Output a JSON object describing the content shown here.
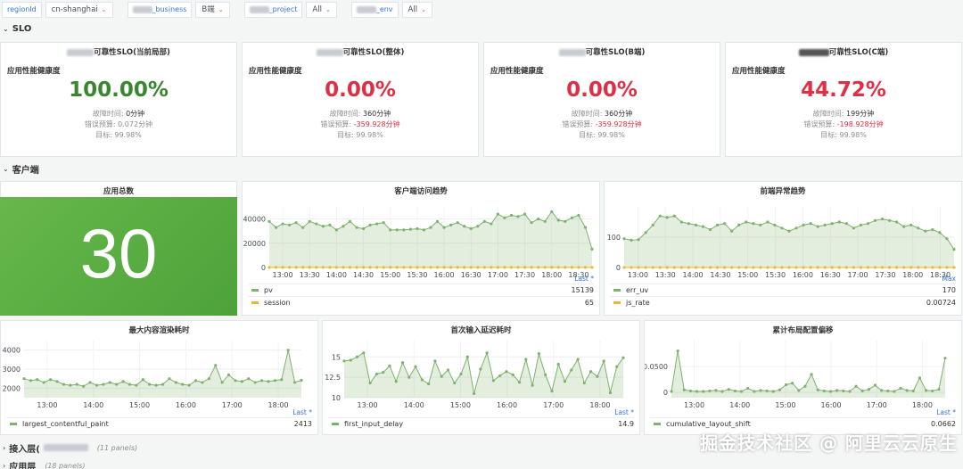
{
  "variables": {
    "region_label": "regionId",
    "region_value": "cn-shanghai",
    "business_label": "_business",
    "business_value": "B端",
    "project_label": "_project",
    "project_value": "All",
    "env_label": "_env",
    "env_value": "All"
  },
  "rows": {
    "slo": "SLO",
    "client": "客户端",
    "access": "接入层(",
    "access_count": "(11 panels)",
    "app": "应用层",
    "app_count": "(18 panels)"
  },
  "slo_panels": [
    {
      "title": "可靠性SLO(当前局部)",
      "subtitle": "应用性能健康度",
      "value": "100.00%",
      "color": "#37872d",
      "downtime_label": "故障时间:",
      "downtime": "0分钟",
      "budget_label": "错误预算:",
      "budget": "0.072分钟",
      "target_label": "目标:",
      "target": "99.98%"
    },
    {
      "title": "可靠性SLO(整体)",
      "subtitle": "应用性能健康度",
      "value": "0.00%",
      "color": "#e02f44",
      "downtime_label": "故障时间:",
      "downtime": "360分钟",
      "budget_label": "错误预算:",
      "budget": "-359.928分钟",
      "target_label": "目标:",
      "target": "99.98%"
    },
    {
      "title": "可靠性SLO(B端)",
      "subtitle": "应用性能健康度",
      "value": "0.00%",
      "color": "#e02f44",
      "downtime_label": "故障时间:",
      "downtime": "360分钟",
      "budget_label": "错误预算:",
      "budget": "-359.928分钟",
      "target_label": "目标:",
      "target": "99.98%"
    },
    {
      "title": "可靠性SLO(C端)",
      "subtitle": "应用性能健康度",
      "value": "44.72%",
      "color": "#e02f44",
      "downtime_label": "故障时间:",
      "downtime": "199分钟",
      "budget_label": "错误预算:",
      "budget": "-198.928分钟",
      "target_label": "目标:",
      "target": "99.98%"
    }
  ],
  "app_total": {
    "title": "应用总数",
    "value": "30"
  },
  "chart_data": [
    {
      "type": "line",
      "title": "客户端访问趋势",
      "x": [
        "13:00",
        "13:30",
        "14:00",
        "14:30",
        "15:00",
        "15:30",
        "16:00",
        "16:30",
        "17:00",
        "17:30",
        "18:00",
        "18:30"
      ],
      "ylim": [
        0,
        50000
      ],
      "yticks": [
        "0",
        "20000",
        "40000"
      ],
      "legend_header": "Last *",
      "series": [
        {
          "name": "pv",
          "color": "#7eb26d",
          "last": "15139",
          "values": [
            38000,
            33000,
            36000,
            35000,
            37000,
            33000,
            38000,
            36000,
            34000,
            35000,
            31000,
            34000,
            38000,
            33000,
            32000,
            35000,
            36000,
            37000,
            31000,
            31000,
            31000,
            31500,
            32000,
            31000,
            33000,
            38000,
            33000,
            35000,
            37000,
            34000,
            32000,
            34000,
            38000,
            36000,
            44000,
            41000,
            43000,
            42000,
            44000,
            37000,
            40000,
            38000,
            46000,
            39000,
            38000,
            41000,
            43000,
            33000,
            15139
          ]
        },
        {
          "name": "session",
          "color": "#eab839",
          "last": "65",
          "values": [
            65,
            65,
            65,
            65,
            65,
            65,
            65,
            65,
            65,
            65,
            65,
            65,
            65,
            65,
            65,
            65,
            65,
            65,
            65,
            65,
            65,
            65,
            65,
            65,
            65,
            65,
            65,
            65,
            65,
            65,
            65,
            65,
            65,
            65,
            65,
            65,
            65,
            65,
            65,
            65,
            65,
            65,
            65,
            65,
            65,
            65,
            65,
            65,
            65
          ]
        }
      ]
    },
    {
      "type": "line",
      "title": "前端异常趋势",
      "x": [
        "13:00",
        "13:30",
        "14:00",
        "14:30",
        "15:00",
        "15:30",
        "16:00",
        "16:30",
        "17:00",
        "17:30",
        "18:00",
        "18:30"
      ],
      "ylim": [
        0,
        200
      ],
      "yticks": [
        "0",
        "100"
      ],
      "legend_header": "Max",
      "series": [
        {
          "name": "err_uv",
          "color": "#7eb26d",
          "last": "170",
          "values": [
            95,
            90,
            92,
            115,
            140,
            170,
            165,
            170,
            150,
            145,
            140,
            135,
            125,
            140,
            145,
            120,
            140,
            150,
            145,
            140,
            150,
            140,
            130,
            120,
            130,
            140,
            145,
            135,
            140,
            145,
            150,
            145,
            130,
            140,
            145,
            155,
            160,
            155,
            150,
            135,
            140,
            130,
            120,
            125,
            115,
            95,
            60
          ]
        },
        {
          "name": "js_rate",
          "color": "#eab839",
          "last": "0.00724",
          "values": [
            0,
            0,
            0,
            0,
            0,
            0,
            0,
            0,
            0,
            0,
            0,
            0,
            0,
            0,
            0,
            0,
            0,
            0,
            0,
            0,
            0,
            0,
            0,
            0,
            0,
            0,
            0,
            0,
            0,
            0,
            0,
            0,
            0,
            0,
            0,
            0,
            0,
            0,
            0,
            0,
            0,
            0,
            0,
            0,
            0,
            0,
            0
          ]
        }
      ]
    },
    {
      "type": "line",
      "title": "最大内容渲染耗时",
      "x": [
        "13:00",
        "14:00",
        "15:00",
        "16:00",
        "17:00",
        "18:00"
      ],
      "ylim": [
        1500,
        4500
      ],
      "yticks": [
        "2000",
        "3000",
        "4000"
      ],
      "legend_header": "Last *",
      "series": [
        {
          "name": "largest_contentful_paint",
          "color": "#7eb26d",
          "last": "2413",
          "values": [
            2500,
            2400,
            2450,
            2300,
            2450,
            2350,
            2200,
            2150,
            2200,
            2100,
            2300,
            2150,
            2200,
            2300,
            2200,
            2350,
            2200,
            2150,
            2450,
            2200,
            2150,
            2200,
            2500,
            2300,
            2200,
            2150,
            2400,
            2300,
            2500,
            3200,
            2300,
            2700,
            2400,
            2350,
            2500,
            2300,
            2400,
            2350,
            2400,
            2450,
            4000,
            2300,
            2413
          ]
        }
      ]
    },
    {
      "type": "line",
      "title": "首次输入延迟耗时",
      "x": [
        "13:00",
        "14:00",
        "15:00",
        "16:00",
        "17:00",
        "18:00"
      ],
      "ylim": [
        10,
        17
      ],
      "yticks": [
        "10",
        "12.5",
        "15"
      ],
      "legend_header": "Last *",
      "series": [
        {
          "name": "first_input_delay",
          "color": "#7eb26d",
          "last": "14.9",
          "values": [
            14.5,
            14.6,
            15.0,
            15.5,
            11.8,
            12.9,
            13.1,
            13.9,
            12.0,
            14.3,
            12.5,
            13.8,
            12.2,
            11.7,
            14.5,
            12.6,
            13.4,
            11.8,
            12.9,
            15.0,
            10.5,
            13.5,
            15.5,
            12.1,
            12.7,
            13.2,
            12.8,
            11.9,
            14.7,
            11.5,
            15.4,
            12.8,
            10.8,
            14.1,
            12.0,
            13.4,
            14.7,
            11.8,
            13.2,
            12.6,
            14.5,
            10.6,
            13.8,
            14.9
          ]
        }
      ]
    },
    {
      "type": "line",
      "title": "累计布局配置偏移",
      "x": [
        "13:00",
        "14:00",
        "15:00",
        "16:00",
        "17:00",
        "18:00"
      ],
      "ylim": [
        -0.01,
        0.1
      ],
      "yticks": [
        "0",
        "0.0500"
      ],
      "legend_header": "Last *",
      "series": [
        {
          "name": "cumulative_layout_shift",
          "color": "#7eb26d",
          "last": "0.0662",
          "values": [
            0.002,
            0.08,
            0.005,
            0.003,
            0.002,
            0.002,
            0.003,
            0.004,
            0.002,
            0.006,
            0.003,
            0.002,
            0.008,
            0.002,
            0.004,
            0.003,
            0.002,
            0.005,
            0.015,
            0.018,
            0.004,
            0.012,
            0.035,
            0.005,
            0.003,
            0.002,
            0.004,
            0.003,
            0.002,
            0.012,
            0.003,
            0.006,
            0.014,
            0.004,
            0.003,
            0.002,
            0.008,
            0.004,
            0.003,
            0.028,
            0.004,
            0.003,
            0.006,
            0.0662
          ]
        }
      ]
    }
  ],
  "watermark": "掘金技术社区 @ 阿里云云原生"
}
